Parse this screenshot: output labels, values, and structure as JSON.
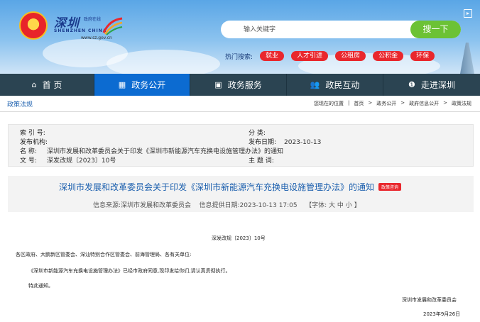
{
  "header": {
    "emblem_glyph": "★",
    "logo_cn": "深圳",
    "logo_small": "政府在线",
    "logo_en": "SHENZHEN CHINA",
    "logo_url": "www.sz.gov.cn",
    "search_placeholder": "输入关键字",
    "search_button": "搜一下",
    "hot_label": "热门搜索:",
    "hot_tags": [
      "就业",
      "人才引进",
      "公租房",
      "公积金",
      "环保"
    ]
  },
  "nav": {
    "items": [
      {
        "icon": "home-icon",
        "glyph": "⌂",
        "label": "首  页"
      },
      {
        "icon": "grid-icon",
        "glyph": "▦",
        "label": "政务公开"
      },
      {
        "icon": "monitor-icon",
        "glyph": "▣",
        "label": "政务服务"
      },
      {
        "icon": "people-icon",
        "glyph": "👥",
        "label": "政民互动"
      },
      {
        "icon": "pin-icon",
        "glyph": "❶",
        "label": "走进深圳"
      }
    ]
  },
  "breadcrumb": {
    "section": "政策法规",
    "location_label": "您现在的位置",
    "path": [
      "首页",
      "政务公开",
      "政府信息公开",
      "政策法规"
    ]
  },
  "meta": {
    "index_label": "索 引 号:",
    "index_value": "",
    "category_label": "分  类:",
    "category_value": "",
    "issuer_label": "发布机构:",
    "issuer_value": "",
    "date_label": "发布日期:",
    "date_value": "2023-10-13",
    "name_label": "名  称:",
    "name_value": "深圳市发展和改革委员会关于印发《深圳市新能源汽车充换电设施管理办法》的通知",
    "docno_label": "文  号:",
    "docno_value": "深发改规〔2023〕10号",
    "subject_label": "主 题 词:",
    "subject_value": ""
  },
  "article": {
    "title": "深圳市发展和改革委员会关于印发《深圳市新能源汽车充换电设施管理办法》的通知",
    "badge": "政策咨询",
    "source": "信息来源:深圳市发展和改革委员会",
    "date": "信息提供日期:2023-10-13 17:05",
    "font": "【字体:",
    "font_large": "大",
    "font_medium": "中",
    "font_small": "小",
    "font_end": "】",
    "docno": "深发改规〔2023〕10号",
    "addressee": "各区政府、大鹏新区管委会、深汕特别合作区管委会、前海管理局、各有关单位:",
    "para1": "《深圳市新能源汽车充换电设施管理办法》已经市政府同意,现印发给你们,请认真贯彻执行。",
    "para2": "特此通知。",
    "signature": "深圳市发展和改革委员会",
    "signdate": "2023年9月26日"
  }
}
